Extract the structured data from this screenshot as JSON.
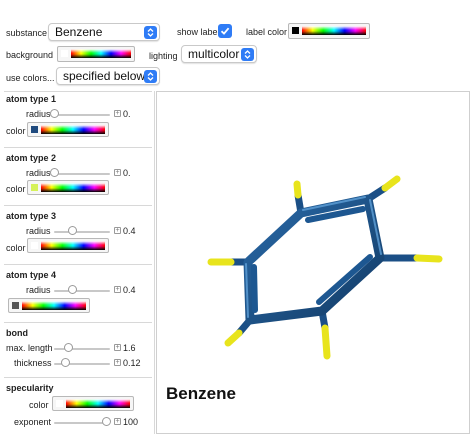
{
  "top": {
    "substance_label": "substance",
    "substance_value": "Benzene",
    "show_label_label": "show label",
    "show_label_checked": true,
    "label_color_label": "label color",
    "label_color": "#000000",
    "background_label": "background",
    "background_color": "#ffffff",
    "lighting_label": "lighting",
    "lighting_value": "multicolor",
    "use_colors_label": "use colors...",
    "use_colors_value": "specified below"
  },
  "sidebar": {
    "atom1": {
      "title": "atom type 1",
      "radius_label": "radius",
      "radius_value": "0.",
      "radius_fraction": 0.0,
      "color_label": "color",
      "color": "#1f4a7e"
    },
    "atom2": {
      "title": "atom type 2",
      "radius_label": "radius",
      "radius_value": "0.",
      "radius_fraction": 0.0,
      "color_label": "color",
      "color": "#d6f25a"
    },
    "atom3": {
      "title": "atom type 3",
      "radius_label": "radius",
      "radius_value": "0.4",
      "radius_fraction": 0.33,
      "color_label": "color",
      "color": "#ffffff"
    },
    "atom4": {
      "title": "atom type 4",
      "radius_label": "radius",
      "radius_value": "0.4",
      "radius_fraction": 0.33,
      "color": "#555555"
    },
    "bond": {
      "title": "bond",
      "max_length_label": "max. length",
      "max_length_value": "1.6",
      "max_length_fraction": 0.25,
      "thickness_label": "thickness",
      "thickness_value": "0.12",
      "thickness_fraction": 0.2
    },
    "specularity": {
      "title": "specularity",
      "color_label": "color",
      "color": "#ffffff",
      "exponent_label": "exponent",
      "exponent_value": "100",
      "exponent_fraction": 0.92
    }
  },
  "view": {
    "caption": "Benzene",
    "molecule": {
      "bond_color": "#1b4f86",
      "carbon_color": "#1b4f86",
      "hydrogen_color": "#e8e41c"
    }
  },
  "colors": {
    "accent": "#2f7cf6"
  }
}
